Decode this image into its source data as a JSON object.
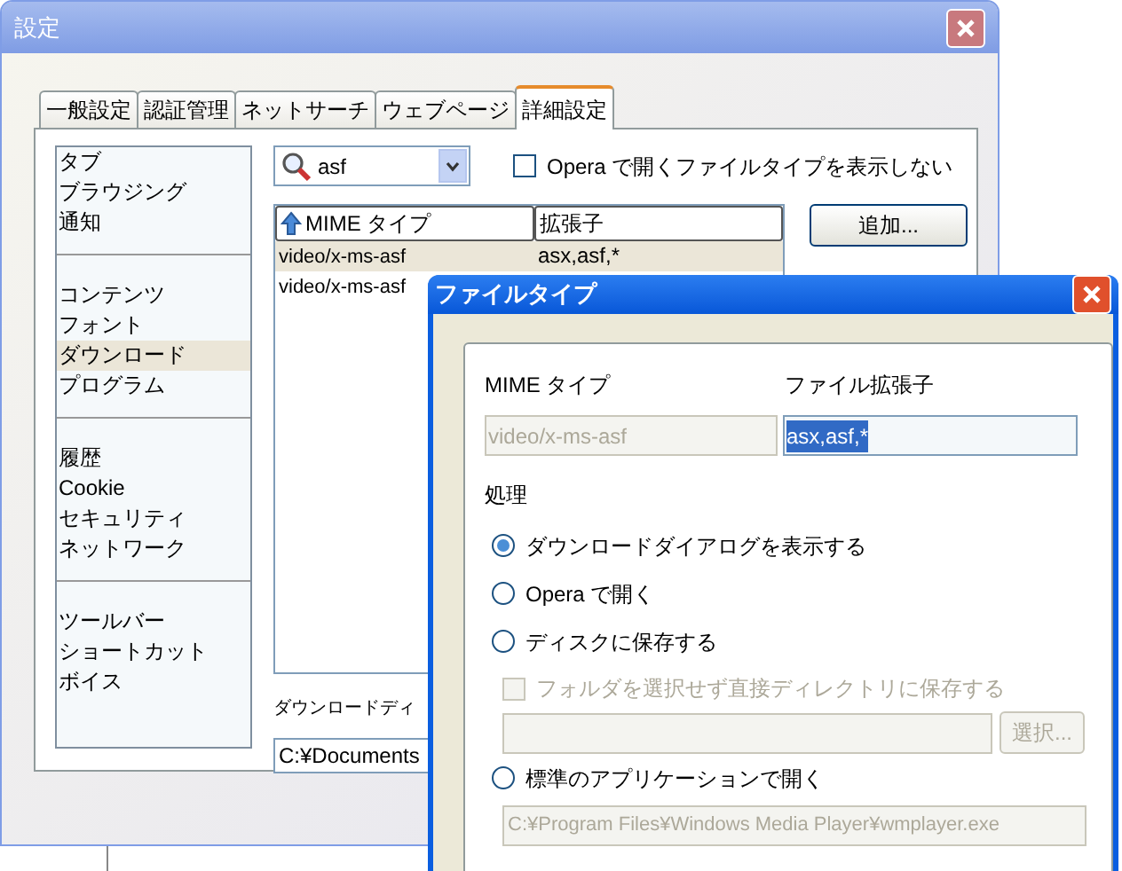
{
  "main_window": {
    "title": "設定",
    "tabs": [
      {
        "label": "一般設定",
        "selected": false
      },
      {
        "label": "認証管理",
        "selected": false
      },
      {
        "label": "ネットサーチ",
        "selected": false
      },
      {
        "label": "ウェブページ",
        "selected": false
      },
      {
        "label": "詳細設定",
        "selected": true
      }
    ],
    "sidebar": {
      "groups": [
        {
          "items": [
            {
              "label": "タブ",
              "selected": false
            },
            {
              "label": "ブラウジング",
              "selected": false
            },
            {
              "label": "通知",
              "selected": false
            }
          ]
        },
        {
          "items": [
            {
              "label": "コンテンツ",
              "selected": false
            },
            {
              "label": "フォント",
              "selected": false
            },
            {
              "label": "ダウンロード",
              "selected": true
            },
            {
              "label": "プログラム",
              "selected": false
            }
          ]
        },
        {
          "items": [
            {
              "label": "履歴",
              "selected": false
            },
            {
              "label": "Cookie",
              "selected": false
            },
            {
              "label": "セキュリティ",
              "selected": false
            },
            {
              "label": "ネットワーク",
              "selected": false
            }
          ]
        },
        {
          "items": [
            {
              "label": "ツールバー",
              "selected": false
            },
            {
              "label": "ショートカット",
              "selected": false
            },
            {
              "label": "ボイス",
              "selected": false
            }
          ]
        }
      ]
    },
    "search": {
      "value": "asf"
    },
    "hide_checkbox": {
      "label": "Opera で開くファイルタイプを表示しない",
      "checked": false
    },
    "file_types": {
      "columns": [
        "MIME タイプ",
        "拡張子"
      ],
      "rows": [
        {
          "cells": [
            "video/x-ms-asf",
            "asx,asf,*"
          ],
          "selected": true
        },
        {
          "cells": [
            "video/x-ms-asf"
          ],
          "selected": false
        }
      ]
    },
    "buttons": [
      "追加..."
    ],
    "download_dir": {
      "label": "ダウンロードディ",
      "value": "C:¥Documents"
    }
  },
  "dialog": {
    "title": "ファイルタイプ",
    "mime_label": "MIME タイプ",
    "mime_value": "video/x-ms-asf",
    "ext_label": "ファイル拡張子",
    "ext_value": "asx,asf,*",
    "action_label": "処理",
    "options": [
      {
        "label": "ダウンロードダイアログを表示する",
        "selected": true
      },
      {
        "label": "Opera で開く",
        "selected": false
      },
      {
        "label": "ディスクに保存する",
        "selected": false,
        "folder_checkbox": {
          "label": "フォルダを選択せず直接ディレクトリに保存する",
          "checked": false,
          "disabled": true
        },
        "browse_button": {
          "label": "選択...",
          "disabled": true
        }
      },
      {
        "label": "標準のアプリケーションで開く",
        "selected": false,
        "app_path": {
          "value": "C:¥Program Files¥Windows Media Player¥wmplayer.exe",
          "disabled": true
        }
      }
    ]
  }
}
